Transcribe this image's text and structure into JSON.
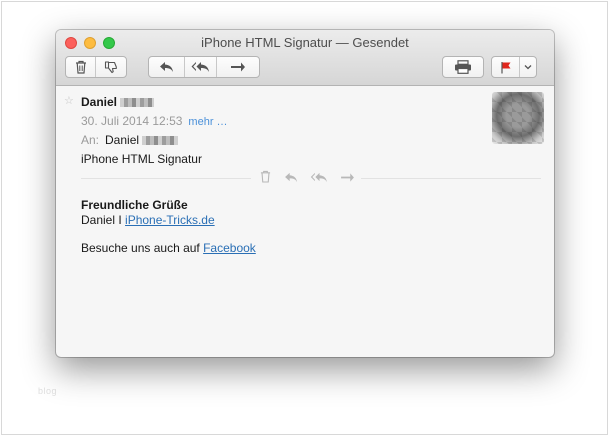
{
  "window": {
    "title": "iPhone HTML Signatur — Gesendet"
  },
  "toolbar": {
    "buttons": [
      {
        "name": "delete",
        "icon": "trash-icon"
      },
      {
        "name": "junk",
        "icon": "thumbs-down-icon"
      },
      {
        "name": "reply",
        "icon": "reply-icon"
      },
      {
        "name": "reply-all",
        "icon": "reply-all-icon"
      },
      {
        "name": "forward",
        "icon": "forward-icon"
      },
      {
        "name": "print",
        "icon": "printer-icon"
      },
      {
        "name": "flag",
        "icon": "flag-icon",
        "color": "#e0261d"
      },
      {
        "name": "flag-menu",
        "icon": "chevron-down-icon"
      }
    ]
  },
  "message": {
    "sender": "Daniel",
    "date": "30. Juli 2014 12:53",
    "more_link": "mehr …",
    "to_label": "An:",
    "to_name": "Daniel",
    "subject": "iPhone HTML Signatur"
  },
  "body": {
    "greeting": "Freundliche Grüße",
    "signature_name": "Daniel I ",
    "signature_link": "iPhone-Tricks.de",
    "visit_text": "Besuche uns auch auf ",
    "facebook_link": "Facebook"
  },
  "watermark": "blog",
  "colors": {
    "link": "#2a6fb5",
    "more_link": "#4a90d9",
    "flag": "#e0261d",
    "traffic_close": "#fc605c",
    "traffic_minimize": "#fdbc40",
    "traffic_zoom": "#34c84a"
  }
}
